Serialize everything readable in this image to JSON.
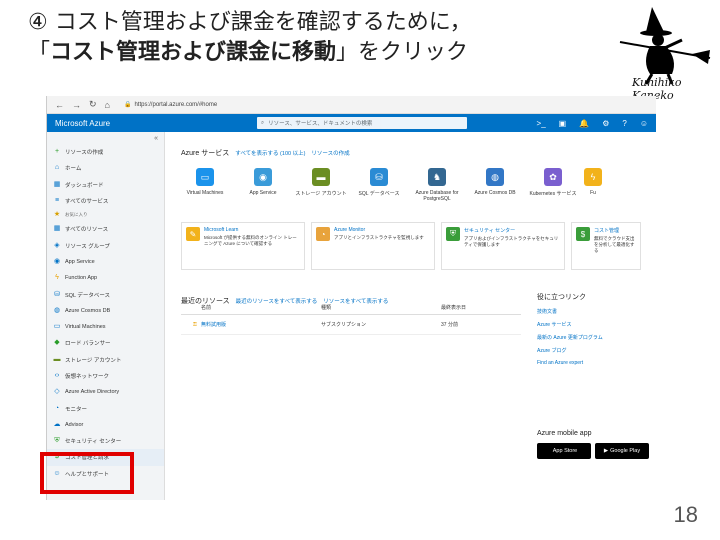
{
  "slide": {
    "title_line1": "④ コスト管理および課金を確認するために，",
    "title_line2_open": "「",
    "title_line2_bold": "コスト管理および課金に移動",
    "title_line2_close": "」をクリック",
    "signature": "Kunihiko Kaneko",
    "page_number": "18"
  },
  "browser": {
    "url": "https://portal.azure.com/#home",
    "lock_icon": "lock-icon"
  },
  "topbar": {
    "brand": "Microsoft Azure",
    "search_placeholder": "リソース、サービス、ドキュメントの検索",
    "accent_color": "#0072c6"
  },
  "sidebar": {
    "items": [
      {
        "label": "リソースの作成",
        "icon": "plus-icon"
      },
      {
        "label": "ホーム",
        "icon": "home-icon"
      },
      {
        "label": "ダッシュボード",
        "icon": "dashboard-icon"
      },
      {
        "label": "すべてのサービス",
        "icon": "list-icon"
      },
      {
        "label": "お気に入り",
        "icon": "star-icon"
      },
      {
        "label": "すべてのリソース",
        "icon": "grid-icon"
      },
      {
        "label": "リソース グループ",
        "icon": "cube-icon"
      },
      {
        "label": "App Service",
        "icon": "globe-icon"
      },
      {
        "label": "Function App",
        "icon": "bolt-icon"
      },
      {
        "label": "SQL データベース",
        "icon": "db-icon"
      },
      {
        "label": "Azure Cosmos DB",
        "icon": "planet-icon"
      },
      {
        "label": "Virtual Machines",
        "icon": "monitor-icon"
      },
      {
        "label": "ロード バランサー",
        "icon": "balancer-icon"
      },
      {
        "label": "ストレージ アカウント",
        "icon": "storage-icon"
      },
      {
        "label": "仮想ネットワーク",
        "icon": "network-icon"
      },
      {
        "label": "Azure Active Directory",
        "icon": "diamond-icon"
      },
      {
        "label": "モニター",
        "icon": "gauge-icon"
      },
      {
        "label": "Advisor",
        "icon": "cloud-icon"
      },
      {
        "label": "セキュリティ センター",
        "icon": "shield-icon"
      },
      {
        "label": "コスト管理と請求",
        "icon": "cost-icon"
      },
      {
        "label": "ヘルプとサポート",
        "icon": "person-icon"
      }
    ]
  },
  "main": {
    "services_heading": "Azure サービス",
    "services_link1": "すべてを表示する (100 以上)",
    "services_link2": "リソースの作成",
    "services": [
      {
        "label": "Virtual Machines",
        "color": "#1b93eb",
        "icon": "monitor-icon"
      },
      {
        "label": "App Service",
        "color": "#3a9bd9",
        "icon": "globe-icon"
      },
      {
        "label": "ストレージ アカウント",
        "color": "#6b8e23",
        "icon": "storage-icon"
      },
      {
        "label": "SQL データベース",
        "color": "#2a8bd4",
        "icon": "db-icon"
      },
      {
        "label": "Azure Database for PostgreSQL",
        "color": "#336791",
        "icon": "elephant-icon"
      },
      {
        "label": "Azure Cosmos DB",
        "color": "#3277c6",
        "icon": "planet-icon"
      },
      {
        "label": "Kubernetes サービス",
        "color": "#7a5fcf",
        "icon": "cluster-icon"
      },
      {
        "label": "Fu",
        "color": "#f2b21b",
        "icon": "bolt-icon"
      }
    ],
    "cards": [
      {
        "title": "Microsoft Learn",
        "desc": "Microsoft が提供する無料のオンライン トレーニングで Azure について確認する",
        "color": "#f2b21b",
        "icon": "learn-icon"
      },
      {
        "title": "Azure Monitor",
        "desc": "アプリとインフラストラクチャを監視します",
        "color": "#e8a33c",
        "icon": "gauge-icon"
      },
      {
        "title": "セキュリティ センター",
        "desc": "アプリおよびインフラストラクチャをセキュリティで保護します",
        "color": "#3a9d3a",
        "icon": "shield-icon"
      },
      {
        "title": "コスト管理",
        "desc": "無料でクラウド支出を分析して最適化する",
        "color": "#3a9d3a",
        "icon": "cost-icon"
      }
    ],
    "recent_heading": "最近のリソース",
    "recent_link1": "最近のリソースをすべて表示する",
    "recent_link2": "リソースをすべて表示する",
    "recent_columns": [
      "名前",
      "種類",
      "最終表示日"
    ],
    "recent_rows": [
      {
        "name": "無料試用版",
        "type": "サブスクリプション",
        "last": "37 分前",
        "icon": "key-icon"
      }
    ],
    "links_heading": "役に立つリンク",
    "links": [
      "技術文書",
      "Azure サービス",
      "最新の Azure 更新プログラム",
      "Azure ブログ",
      "Find an Azure expert"
    ],
    "mobile_heading": "Azure mobile app",
    "app_store": "App Store",
    "google_play": "Google Play"
  }
}
